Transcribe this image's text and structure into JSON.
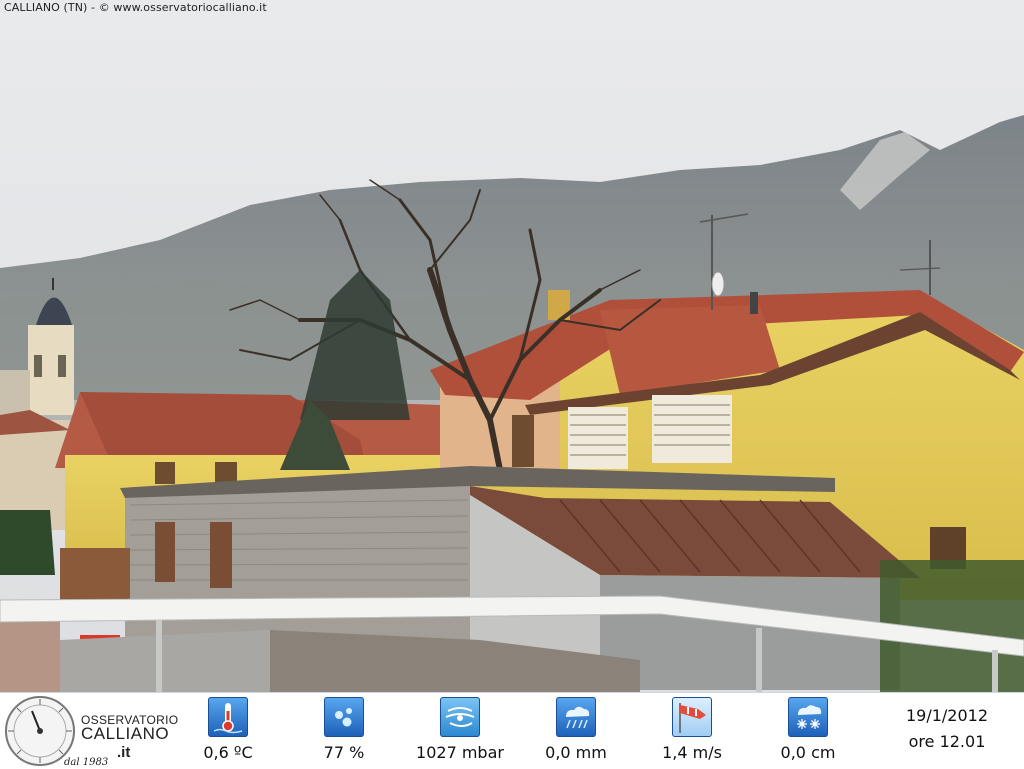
{
  "header": {
    "caption": "CALLIANO (TN) - © www.osservatoriocalliano.it"
  },
  "logo": {
    "line1": "OSSERVATORIO",
    "line2": "CALLIANO",
    "line3": ".it",
    "since": "dal 1983"
  },
  "metrics": [
    {
      "name": "temperature",
      "icon": "thermometer-icon",
      "value": "0,6 ºC"
    },
    {
      "name": "humidity",
      "icon": "water-drops-icon",
      "value": "77 %"
    },
    {
      "name": "pressure",
      "icon": "wind-gauge-icon",
      "value": "1027 mbar"
    },
    {
      "name": "rain",
      "icon": "rain-cloud-icon",
      "value": "0,0 mm"
    },
    {
      "name": "wind",
      "icon": "windsock-icon",
      "value": "1,4 m/s"
    },
    {
      "name": "snow",
      "icon": "snowflake-icon",
      "value": "0,0 cm"
    }
  ],
  "datetime": {
    "date": "19/1/2012",
    "time": "ore 12.01"
  }
}
